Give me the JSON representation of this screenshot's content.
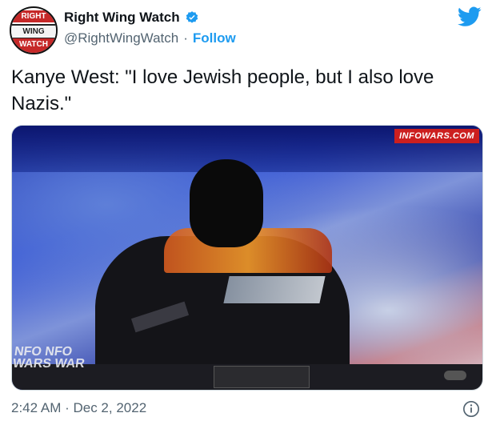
{
  "author": {
    "avatar_lines": [
      "RIGHT",
      "WING",
      "WATCH"
    ],
    "display_name": "Right Wing Watch",
    "handle": "@RightWingWatch",
    "separator": "·",
    "follow_label": "Follow",
    "verified": true
  },
  "tweet": {
    "text": "Kanye West: \"I love Jewish people, but I also love Nazis.\""
  },
  "media": {
    "watermark_tag": "INFOWARS.COM",
    "logo_bug_line1": "NFO NFO",
    "logo_bug_line2": "WARS WAR"
  },
  "footer": {
    "timestamp": "2:42 AM · Dec 2, 2022"
  },
  "icons": [
    "verified-badge-icon",
    "twitter-bird-icon",
    "info-icon"
  ],
  "colors": {
    "link_blue": "#1d9bf0",
    "secondary_text": "#536471",
    "infowars_red": "#cc1f1f"
  }
}
